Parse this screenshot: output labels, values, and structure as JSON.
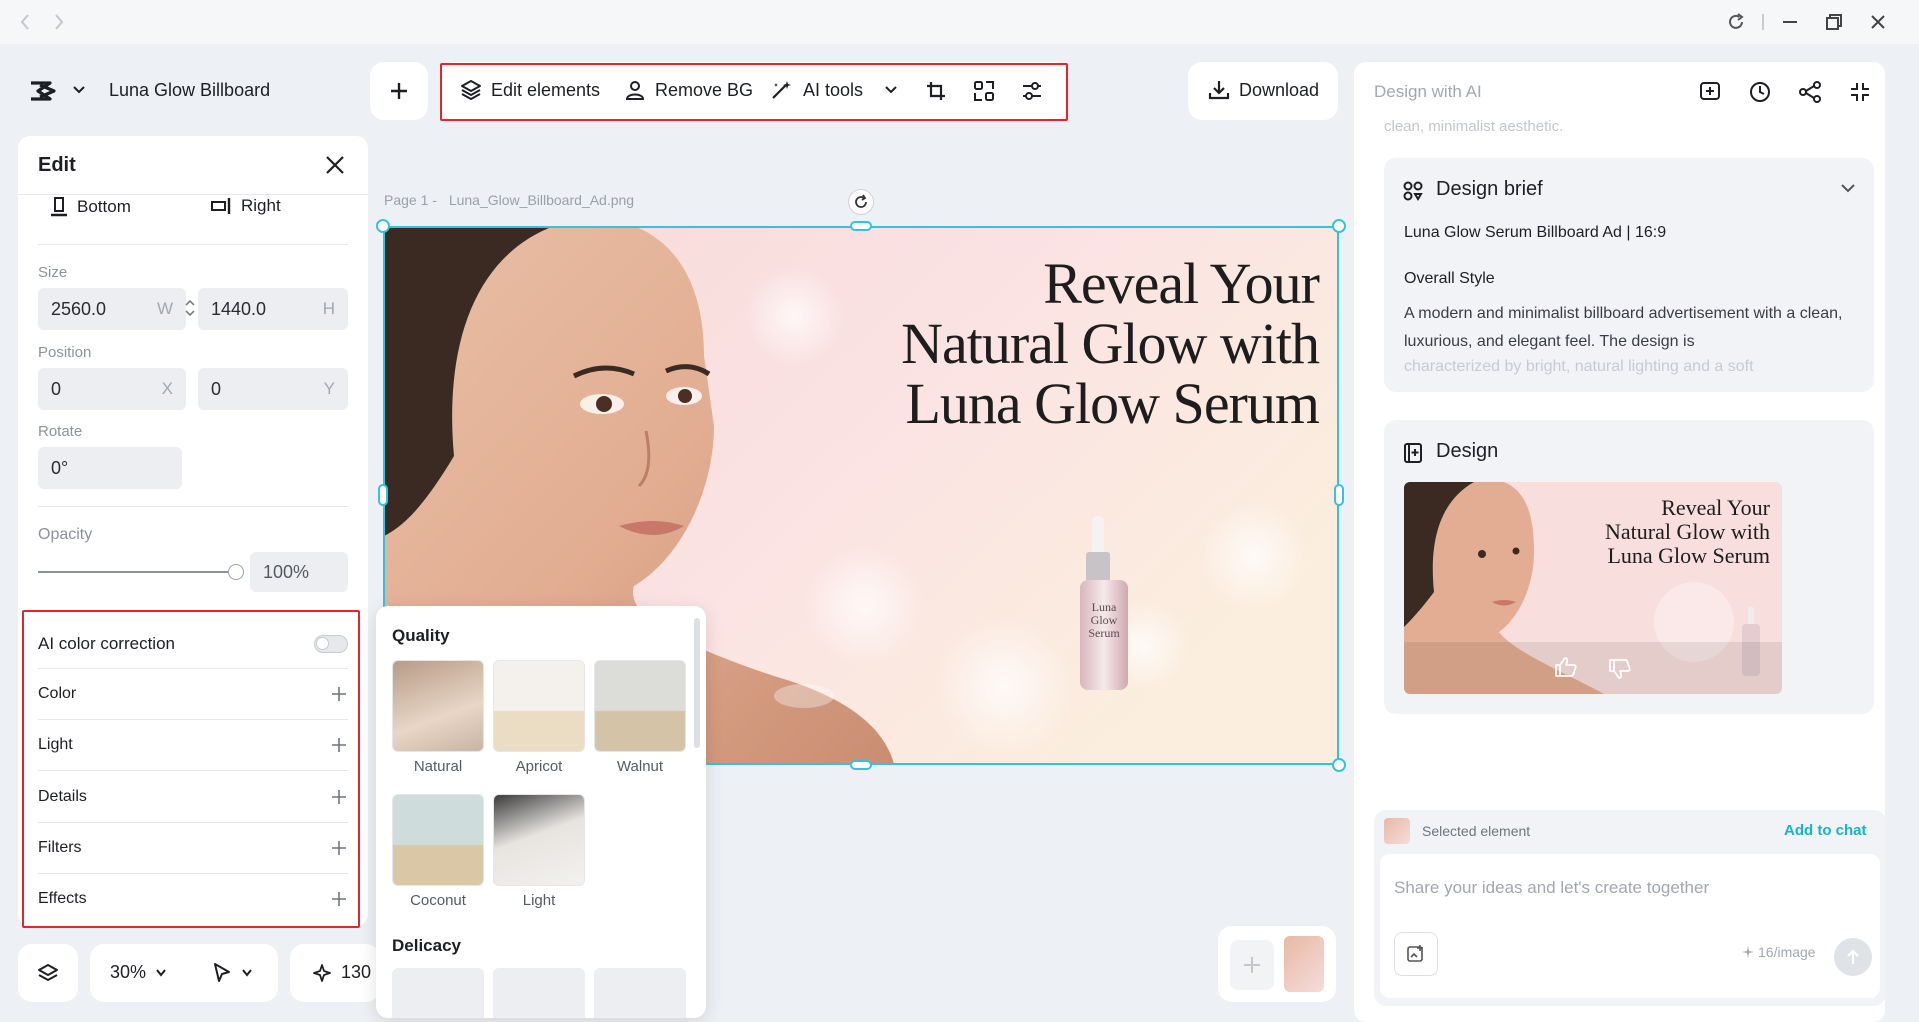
{
  "project": {
    "title": "Luna Glow Billboard"
  },
  "toolbar": {
    "edit_elements": "Edit elements",
    "remove_bg": "Remove BG",
    "ai_tools": "AI tools",
    "download": "Download"
  },
  "edit_panel": {
    "title": "Edit",
    "align_bottom": "Bottom",
    "align_right": "Right",
    "size_label": "Size",
    "width_value": "2560.0",
    "width_suffix": "W",
    "height_value": "1440.0",
    "height_suffix": "H",
    "position_label": "Position",
    "x_value": "0",
    "x_suffix": "X",
    "y_value": "0",
    "y_suffix": "Y",
    "rotate_label": "Rotate",
    "rotate_value": "0°",
    "opacity_label": "Opacity",
    "opacity_value": "100%",
    "opacity_fraction": 1.0,
    "ai_color_correction": "AI color correction",
    "ai_color_correction_on": false,
    "sections": [
      "Color",
      "Light",
      "Details",
      "Filters",
      "Effects"
    ]
  },
  "filters_popup": {
    "quality_title": "Quality",
    "presets": [
      "Natural",
      "Apricot",
      "Walnut",
      "Coconut",
      "Light"
    ],
    "delicacy_title": "Delicacy"
  },
  "bottom_bar": {
    "zoom": "30%",
    "credits": "130"
  },
  "canvas": {
    "page_label": "Page 1 -",
    "file_name": "Luna_Glow_Billboard_Ad.png",
    "headline_line1": "Reveal Your",
    "headline_line2": "Natural Glow with",
    "headline_line3": "Luna Glow Serum",
    "bottle_label": "Luna Glow Serum"
  },
  "ai_panel": {
    "title": "Design with AI",
    "faded_text": "clean, minimalist aesthetic.",
    "brief_title": "Design brief",
    "brief_subtitle": "Luna Glow Serum Billboard Ad | 16:9",
    "overall_style": "Overall Style",
    "brief_body": "A modern and minimalist billboard advertisement with a clean, luxurious, and elegant feel. The design is",
    "brief_faded": "characterized by bright, natural lighting and a soft",
    "design_title": "Design",
    "selected_element": "Selected element",
    "add_to_chat": "Add to chat",
    "chat_placeholder": "Share your ideas and let's create together",
    "cost": "16/image"
  },
  "colors": {
    "accent_cyan": "#35c3d9",
    "highlight_red": "#e0262f",
    "link_teal": "#17b3c7"
  }
}
